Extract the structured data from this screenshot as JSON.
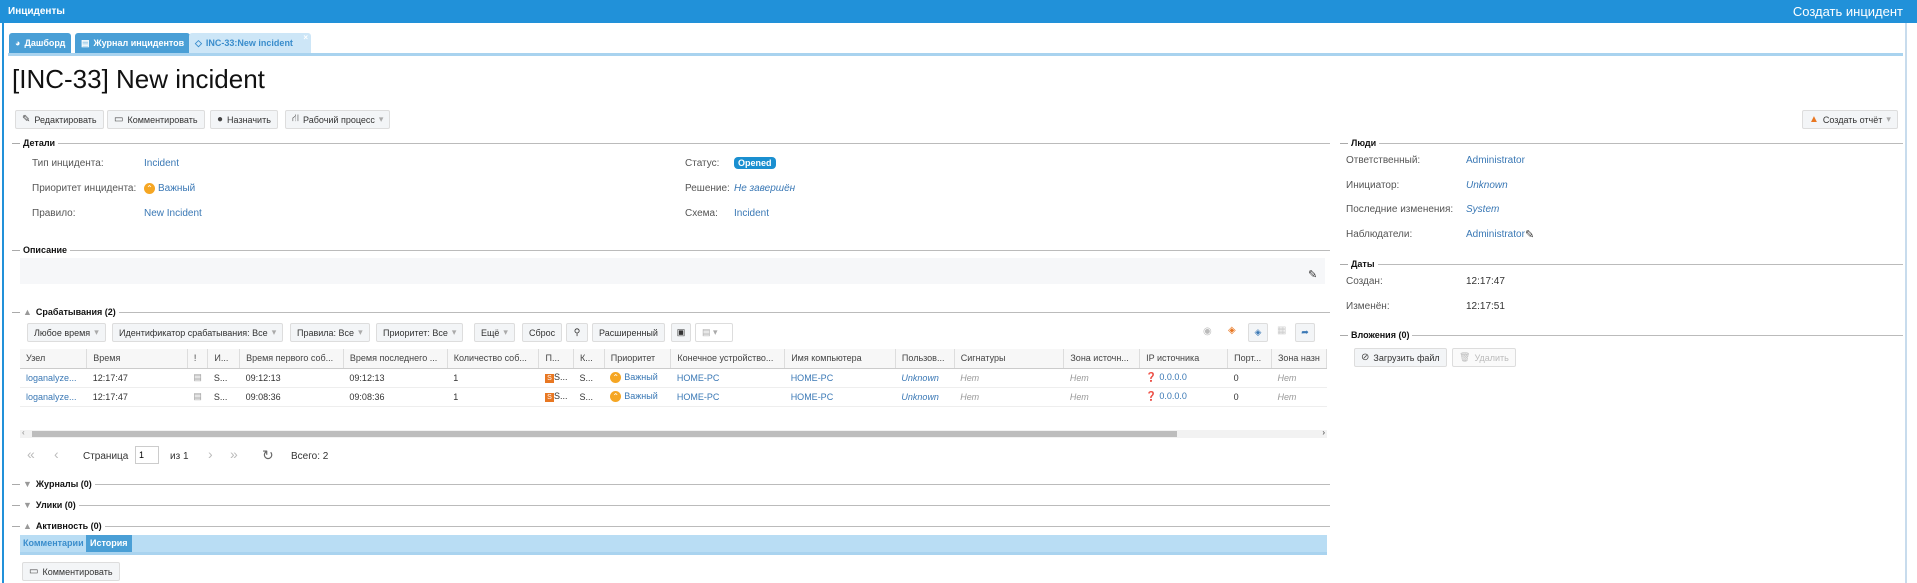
{
  "header": {
    "title": "Инциденты",
    "create_incident": "Создать инцидент"
  },
  "tabs": [
    {
      "label": "Дашборд",
      "icon": "dashboard-icon"
    },
    {
      "label": "Журнал инцидентов",
      "icon": "journal-icon"
    },
    {
      "label": "INC-33:New incident",
      "icon": "tag-icon",
      "close": "×"
    }
  ],
  "page_title": "[INC-33] New incident",
  "toolbar": {
    "edit": "Редактировать",
    "comment": "Комментировать",
    "assign": "Назначить",
    "workflow": "Рабочий процесс",
    "report": "Создать отчёт"
  },
  "details": {
    "legend": "Детали",
    "type_label": "Тип инцидента:",
    "type_value": "Incident",
    "priority_label": "Приоритет инцидента:",
    "priority_value": "Важный",
    "rule_label": "Правило:",
    "rule_value": "New Incident",
    "status_label": "Статус:",
    "status_value": "Opened",
    "resolution_label": "Решение:",
    "resolution_value": "Не завершён",
    "schema_label": "Схема:",
    "schema_value": "Incident"
  },
  "description": {
    "legend": "Описание"
  },
  "triggers": {
    "legend": "Срабатывания (2)",
    "filters": [
      "Любое время",
      "Идентификатор срабатывания: Все",
      "Правила: Все",
      "Приоритет: Все",
      "Ещё"
    ],
    "reset": "Сброс",
    "advanced": "Расширенный",
    "columns": [
      "Узел",
      "Время",
      "!",
      "И...",
      "Время первого соб...",
      "Время последнего ...",
      "Количество соб...",
      "П...",
      "К...",
      "Приоритет",
      "Конечное устройство...",
      "Имя компьютера",
      "Пользов...",
      "Сигнатуры",
      "Зона источн...",
      "IP источника",
      "Порт...",
      "Зона назн"
    ],
    "rows": [
      [
        "loganalyze...",
        "12:17:47",
        "",
        "S...",
        "09:12:13",
        "09:12:13",
        "1",
        "S...",
        "S...",
        "Важный",
        "HOME-PC",
        "HOME-PC",
        "Unknown",
        "Нет",
        "Нет",
        "0.0.0.0",
        "0",
        "Нет"
      ],
      [
        "loganalyze...",
        "12:17:47",
        "",
        "S...",
        "09:08:36",
        "09:08:36",
        "1",
        "S...",
        "S...",
        "Важный",
        "HOME-PC",
        "HOME-PC",
        "Unknown",
        "Нет",
        "Нет",
        "0.0.0.0",
        "0",
        "Нет"
      ]
    ],
    "pager": {
      "page_label": "Страница",
      "page_value": "1",
      "of": "из 1",
      "total": "Всего: 2"
    }
  },
  "sections": {
    "journals": "Журналы (0)",
    "evidence": "Улики (0)",
    "activity": "Активность (0)"
  },
  "activity_tabs": [
    "Комментарии",
    "История"
  ],
  "activity_comment": "Комментировать",
  "people": {
    "legend": "Люди",
    "responsible_label": "Ответственный:",
    "responsible": "Administrator",
    "initiator_label": "Инициатор:",
    "initiator": "Unknown",
    "last_change_label": "Последние изменения:",
    "last_change": "System",
    "observers_label": "Наблюдатели:",
    "observers": "Administrator"
  },
  "dates": {
    "legend": "Даты",
    "created_label": "Создан:",
    "created": "12:17:47",
    "modified_label": "Изменён:",
    "modified": "12:17:51"
  },
  "attachments": {
    "legend": "Вложения (0)",
    "upload": "Загрузить файл",
    "delete": "Удалить"
  },
  "colors": {
    "brand": "#2191d9",
    "status": "#1a8fd0",
    "priority": "#f5a623"
  }
}
